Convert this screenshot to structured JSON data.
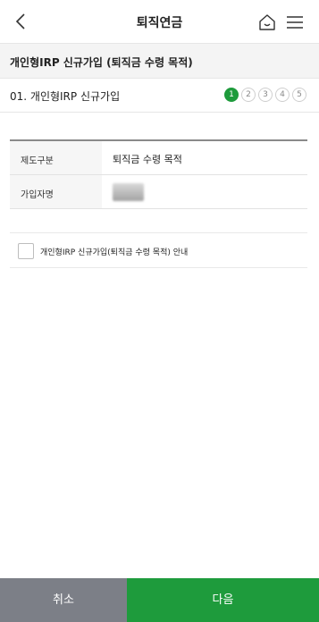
{
  "header": {
    "title": "퇴직연금",
    "back_icon": "chevron-left-icon",
    "home_icon": "home-icon",
    "menu_icon": "hamburger-menu-icon"
  },
  "section": {
    "title": "개인형IRP 신규가입 (퇴직금 수령 목적)"
  },
  "step": {
    "title": "01. 개인형IRP 신규가입",
    "current": 1,
    "items": [
      "1",
      "2",
      "3",
      "4",
      "5"
    ]
  },
  "info": {
    "rows": [
      {
        "label": "제도구분",
        "value": "퇴직금 수령 목적"
      },
      {
        "label": "가입자명",
        "value": ""
      }
    ]
  },
  "notice": {
    "label": "개인형IRP 신규가입(퇴직금 수령 목적) 안내",
    "checked": false
  },
  "buttons": {
    "cancel": "취소",
    "next": "다음"
  },
  "colors": {
    "accent": "#1e9b3c",
    "cancel_bg": "#7c7f87",
    "section_bg": "#f4f4f4"
  }
}
